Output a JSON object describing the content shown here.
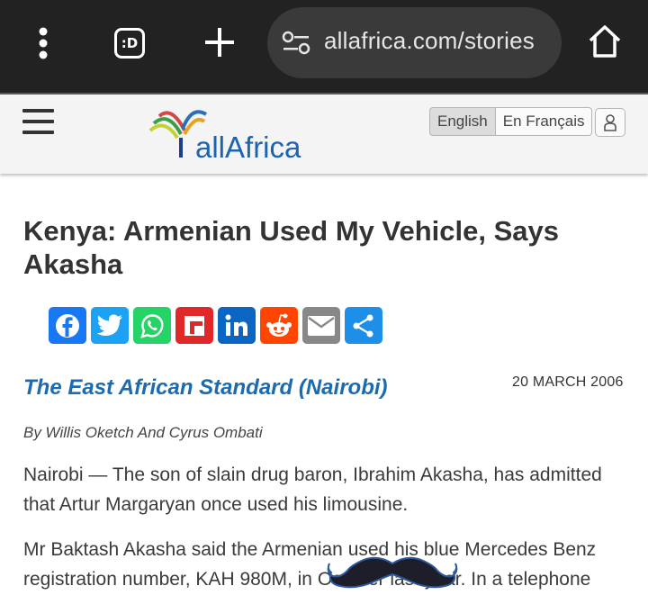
{
  "browser": {
    "tab_count": ":D",
    "url": "allafrica.com/stories"
  },
  "site": {
    "logo_text": "allAfrica",
    "lang_en": "English",
    "lang_fr": "En Français"
  },
  "article": {
    "title": "Kenya: Armenian Used My Vehicle, Says Akasha",
    "share_icons": [
      "facebook-icon",
      "twitter-icon",
      "whatsapp-icon",
      "flipboard-icon",
      "linkedin-icon",
      "reddit-icon",
      "email-icon",
      "share-icon"
    ],
    "share_colors": [
      "#1877f2",
      "#1da1f2",
      "#25d366",
      "#e12828",
      "#0a66c2",
      "#ff4500",
      "#888888",
      "#1e8fe9"
    ],
    "source": "The East African Standard (Nairobi)",
    "date": "20 MARCH 2006",
    "byline": "By Willis Oketch And Cyrus Ombati",
    "paragraph1": "Nairobi — The son of slain drug baron, Ibrahim Akasha, has admitted that Artur Margaryan once used his limousine.",
    "paragraph2_line1": "Mr Baktash Akasha said the Armenian used his blue Mercedes Benz",
    "paragraph2_line2": "registration number, KAH 980M, in October last year. In a telephone"
  }
}
